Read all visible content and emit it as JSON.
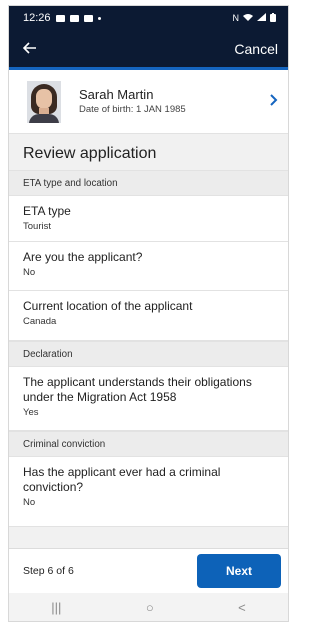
{
  "status_bar": {
    "time": "12:26",
    "right_text": "N"
  },
  "nav": {
    "back_icon": "arrow-left-icon",
    "cancel_label": "Cancel"
  },
  "profile": {
    "name": "Sarah Martin",
    "dob": "Date of birth: 1 JAN 1985",
    "chevron_icon": "chevron-right-icon"
  },
  "title": "Review application",
  "sections": [
    {
      "header": "ETA type and location",
      "rows": [
        {
          "label": "ETA type",
          "value": "Tourist"
        },
        {
          "label": "Are you the applicant?",
          "value": "No"
        },
        {
          "label": "Current location of the applicant",
          "value": "Canada"
        }
      ]
    },
    {
      "header": "Declaration",
      "rows": [
        {
          "label": "The applicant understands their obligations under the Migration Act 1958",
          "value": "Yes"
        }
      ]
    },
    {
      "header": "Criminal conviction",
      "rows": [
        {
          "label": "Has the applicant ever had a criminal conviction?",
          "value": "No"
        }
      ]
    }
  ],
  "footer": {
    "step": "Step 6 of 6",
    "next_label": "Next"
  },
  "system_nav": {
    "recents": "|||",
    "home": "○",
    "back": "<"
  },
  "colors": {
    "header_bg": "#0c1a33",
    "accent": "#0d62b8"
  }
}
